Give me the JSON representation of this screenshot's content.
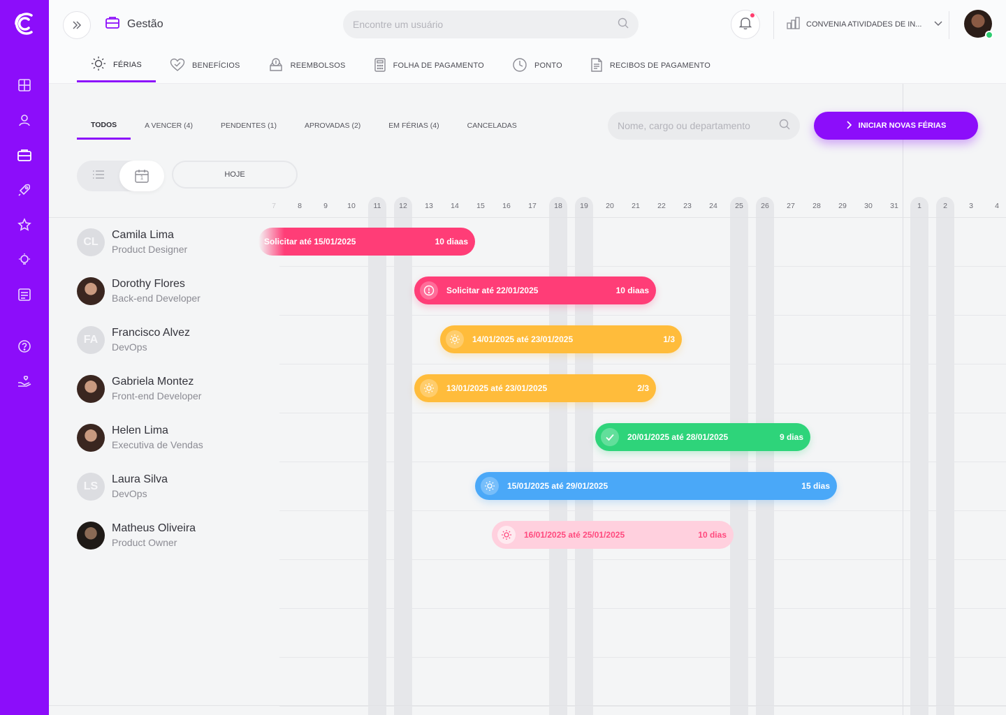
{
  "header": {
    "module_title": "Gestão",
    "search_placeholder": "Encontre um usuário",
    "company_name": "CONVENIA ATIVIDADES DE IN..."
  },
  "main_tabs": [
    {
      "label": "FÉRIAS",
      "icon": "sun-icon",
      "active": true
    },
    {
      "label": "BENEFÍCIOS",
      "icon": "heart-icon",
      "active": false
    },
    {
      "label": "REEMBOLSOS",
      "icon": "money-icon",
      "active": false
    },
    {
      "label": "FOLHA DE PAGAMENTO",
      "icon": "calculator-icon",
      "active": false
    },
    {
      "label": "PONTO",
      "icon": "clock-icon",
      "active": false
    },
    {
      "label": "RECIBOS DE PAGAMENTO",
      "icon": "receipt-icon",
      "active": false
    }
  ],
  "filter_tabs": [
    {
      "label": "TODOS",
      "active": true
    },
    {
      "label": "A VENCER (4)",
      "active": false
    },
    {
      "label": "PENDENTES (1)",
      "active": false
    },
    {
      "label": "APROVADAS (2)",
      "active": false
    },
    {
      "label": "EM FÉRIAS (4)",
      "active": false
    },
    {
      "label": "CANCELADAS",
      "active": false
    }
  ],
  "list_search_placeholder": "Nome, cargo ou departamento",
  "start_button_label": "INICIAR NOVAS FÉRIAS",
  "today_button_label": "HOJE",
  "calendar_icon_day": "1",
  "days": [
    "7",
    "8",
    "9",
    "10",
    "11",
    "12",
    "13",
    "14",
    "15",
    "16",
    "17",
    "18",
    "19",
    "20",
    "21",
    "22",
    "23",
    "24",
    "25",
    "26",
    "27",
    "28",
    "29",
    "30",
    "31",
    "1",
    "2",
    "3",
    "4"
  ],
  "weekend_days": [
    "11",
    "12",
    "18",
    "19",
    "25",
    "26",
    "1",
    "2"
  ],
  "people": [
    {
      "name": "Camila Lima",
      "role": "Product Designer",
      "initials": "CL"
    },
    {
      "name": "Dorothy Flores",
      "role": "Back-end Developer",
      "initials": ""
    },
    {
      "name": "Francisco Alvez",
      "role": "DevOps",
      "initials": "FA"
    },
    {
      "name": "Gabriela Montez",
      "role": "Front-end Developer",
      "initials": ""
    },
    {
      "name": "Helen Lima",
      "role": "Executiva de Vendas",
      "initials": ""
    },
    {
      "name": "Laura Silva",
      "role": "DevOps",
      "initials": "LS"
    },
    {
      "name": "Matheus Oliveira",
      "role": "Product Owner",
      "initials": ""
    }
  ],
  "bars": [
    {
      "text": "Solicitar até 15/01/2025",
      "count": "10 diaas",
      "color": "#ff3d77",
      "status": "overdue"
    },
    {
      "text": "Solicitar até 22/01/2025",
      "count": "10 diaas",
      "color": "#ff3d77",
      "status": "alert"
    },
    {
      "text": "14/01/2025 até 23/01/2025",
      "count": "1/3",
      "color": "#ffbc3b",
      "status": "scheduled"
    },
    {
      "text": "13/01/2025 até 23/01/2025",
      "count": "2/3",
      "color": "#ffbc3b",
      "status": "scheduled"
    },
    {
      "text": "20/01/2025 até 28/01/2025",
      "count": "9 dias",
      "color": "#2ed47a",
      "status": "approved"
    },
    {
      "text": "15/01/2025 até 29/01/2025",
      "count": "15 dias",
      "color": "#4aa8f8",
      "status": "on-vacation"
    },
    {
      "text": "16/01/2025 até 25/01/2025",
      "count": "10 dias",
      "color": "#ffd0de",
      "status": "pending"
    }
  ],
  "colors": {
    "accent": "#8c0dfa",
    "pink": "#ff3d77",
    "yellow": "#ffbc3b",
    "green": "#2ed47a",
    "blue": "#4aa8f8"
  }
}
